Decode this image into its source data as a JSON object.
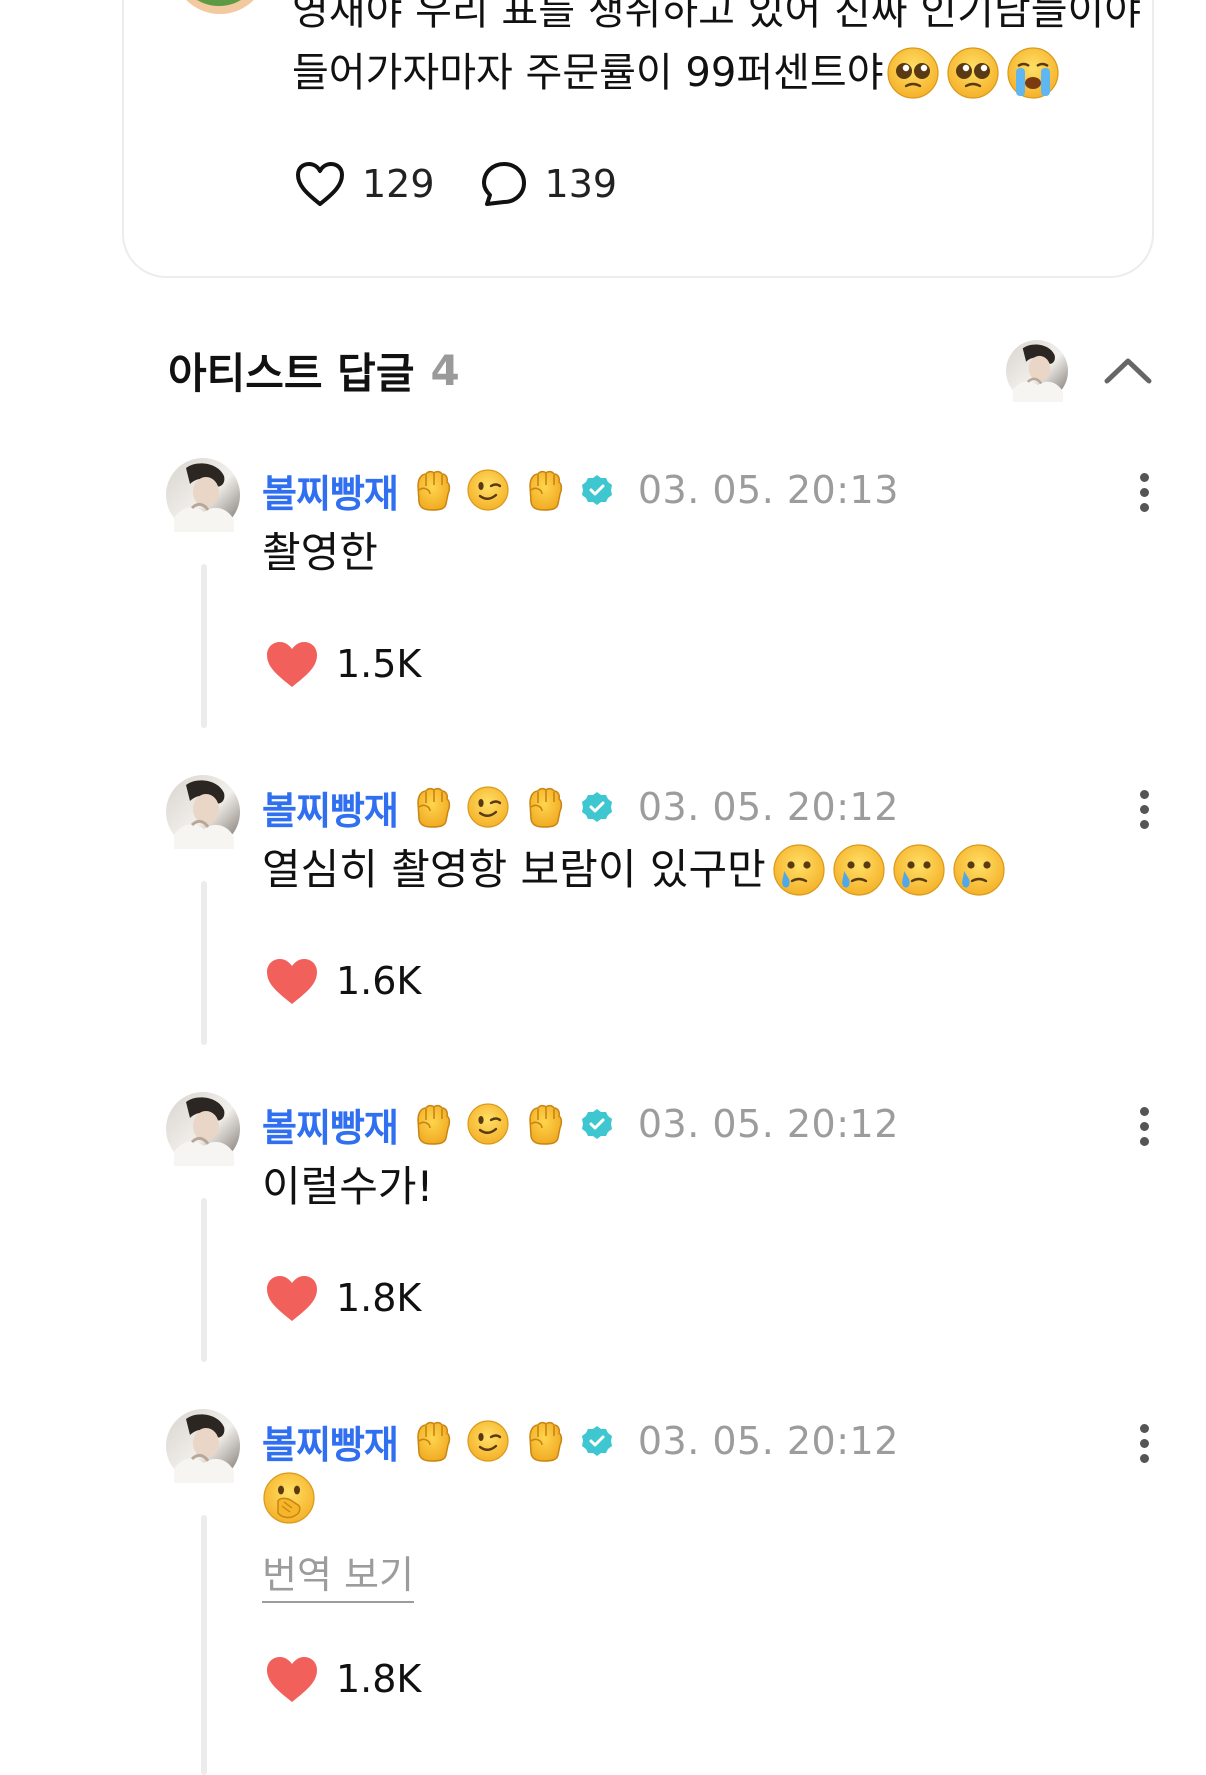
{
  "post": {
    "text_line1": "영재야 우리 표를 쟁취하고 있어 진짜 인기남들이야",
    "text_line2": "들어가자마자 주문률이 99퍼센트야",
    "text_emojis": [
      "pleading-face",
      "pleading-face",
      "loudly-crying-face"
    ],
    "like_count": "129",
    "comment_count": "139"
  },
  "artist_replies": {
    "title": "아티스트 답글",
    "count": "4"
  },
  "replies": [
    {
      "author": "볼찌빵재",
      "badges": [
        "raised-fist",
        "winking-face",
        "raised-fist"
      ],
      "timestamp": "03. 05. 20:13",
      "text": "촬영한",
      "text_emojis": [],
      "likes": "1.5K"
    },
    {
      "author": "볼찌빵재",
      "badges": [
        "raised-fist",
        "winking-face",
        "raised-fist"
      ],
      "timestamp": "03. 05. 20:12",
      "text": "열심히 촬영항 보람이 있구만",
      "text_emojis": [
        "face-holding-back-tears",
        "face-holding-back-tears",
        "face-holding-back-tears",
        "face-holding-back-tears"
      ],
      "likes": "1.6K"
    },
    {
      "author": "볼찌빵재",
      "badges": [
        "raised-fist",
        "winking-face",
        "raised-fist"
      ],
      "timestamp": "03. 05. 20:12",
      "text": "이럴수가!",
      "text_emojis": [],
      "likes": "1.8K"
    },
    {
      "author": "볼찌빵재",
      "badges": [
        "raised-fist",
        "winking-face",
        "raised-fist"
      ],
      "timestamp": "03. 05. 20:12",
      "text": "",
      "text_emojis": [
        "face-with-open-eyes-and-hand-over-mouth"
      ],
      "translate_label": "번역 보기",
      "likes": "1.8K"
    }
  ],
  "colors": {
    "author": "#2f6ff0",
    "verified": "#3ec7d0",
    "heart": "#f2605c",
    "muted": "#9c9c9c"
  }
}
